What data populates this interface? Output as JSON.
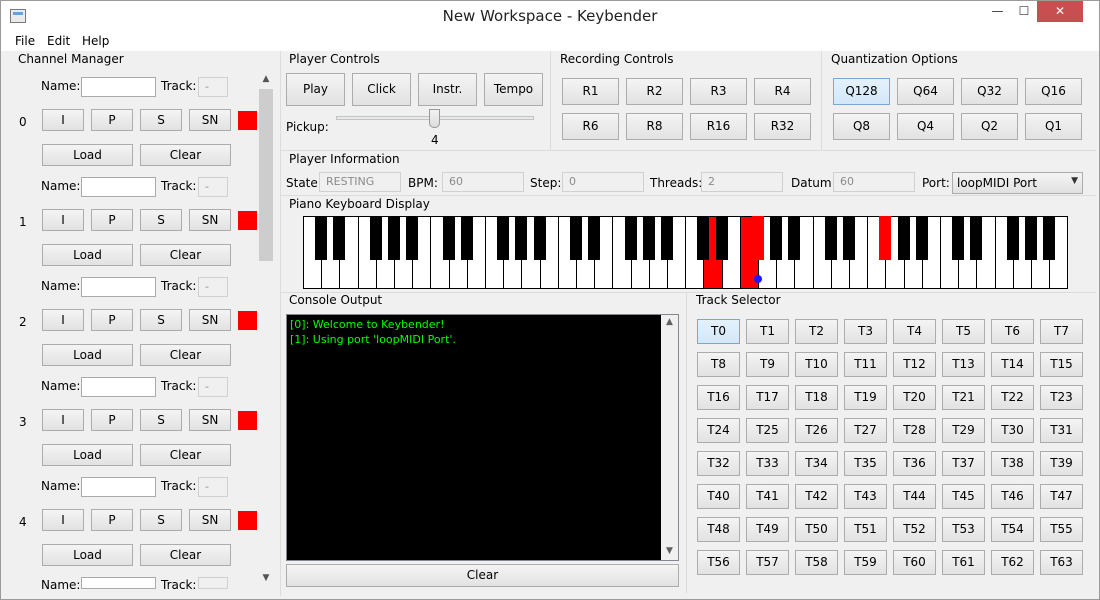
{
  "window": {
    "title": "New Workspace - Keybender",
    "min_label": "—",
    "max_label": "☐",
    "close_label": "✕"
  },
  "menu": [
    "File",
    "Edit",
    "Help"
  ],
  "channel_manager": {
    "title": "Channel Manager",
    "name_label": "Name:",
    "track_label": "Track:",
    "track_value": "-",
    "buttons": [
      "I",
      "P",
      "S",
      "SN"
    ],
    "load_label": "Load",
    "clear_label": "Clear",
    "channels": [
      "0",
      "1",
      "2",
      "3",
      "4"
    ],
    "indicator_color": "#ff0000",
    "next_name_label": "Name:",
    "next_track_label": "Track:"
  },
  "player_controls": {
    "title": "Player Controls",
    "buttons": [
      "Play",
      "Click",
      "Instr.",
      "Tempo"
    ],
    "pickup_label": "Pickup:",
    "pickup_value": "4"
  },
  "recording_controls": {
    "title": "Recording Controls",
    "buttons": [
      "R1",
      "R2",
      "R3",
      "R4",
      "R6",
      "R8",
      "R16",
      "R32"
    ]
  },
  "quantization": {
    "title": "Quantization Options",
    "buttons": [
      "Q128",
      "Q64",
      "Q32",
      "Q16",
      "Q8",
      "Q4",
      "Q2",
      "Q1"
    ],
    "selected": "Q128"
  },
  "player_info": {
    "title": "Player Information",
    "state_label": "State:",
    "state_value": "RESTING",
    "bpm_label": "BPM:",
    "bpm_value": "60",
    "step_label": "Step:",
    "step_value": "0",
    "threads_label": "Threads:",
    "threads_value": "2",
    "datum_label": "Datum:",
    "datum_value": "60",
    "port_label": "Port:",
    "port_value": "loopMIDI Port"
  },
  "piano": {
    "title": "Piano Keyboard Display",
    "white_key_count": 42,
    "pressed_white": [
      22,
      24
    ],
    "pressed_black": [
      24,
      27,
      31
    ],
    "dot_on_black": 24,
    "pressed_color": "#ff0000",
    "dot_color": "#1a1aff"
  },
  "console": {
    "title": "Console Output",
    "lines": [
      "[0]: Welcome to Keybender!",
      "[1]: Using port 'loopMIDI Port'."
    ],
    "clear_label": "Clear"
  },
  "track_selector": {
    "title": "Track Selector",
    "tracks": [
      "T0",
      "T1",
      "T2",
      "T3",
      "T4",
      "T5",
      "T6",
      "T7",
      "T8",
      "T9",
      "T10",
      "T11",
      "T12",
      "T13",
      "T14",
      "T15",
      "T16",
      "T17",
      "T18",
      "T19",
      "T20",
      "T21",
      "T22",
      "T23",
      "T24",
      "T25",
      "T26",
      "T27",
      "T28",
      "T29",
      "T30",
      "T31",
      "T32",
      "T33",
      "T34",
      "T35",
      "T36",
      "T37",
      "T38",
      "T39",
      "T40",
      "T41",
      "T42",
      "T43",
      "T44",
      "T45",
      "T46",
      "T47",
      "T48",
      "T49",
      "T50",
      "T51",
      "T52",
      "T53",
      "T54",
      "T55",
      "T56",
      "T57",
      "T58",
      "T59",
      "T60",
      "T61",
      "T62",
      "T63"
    ],
    "selected": "T0"
  }
}
